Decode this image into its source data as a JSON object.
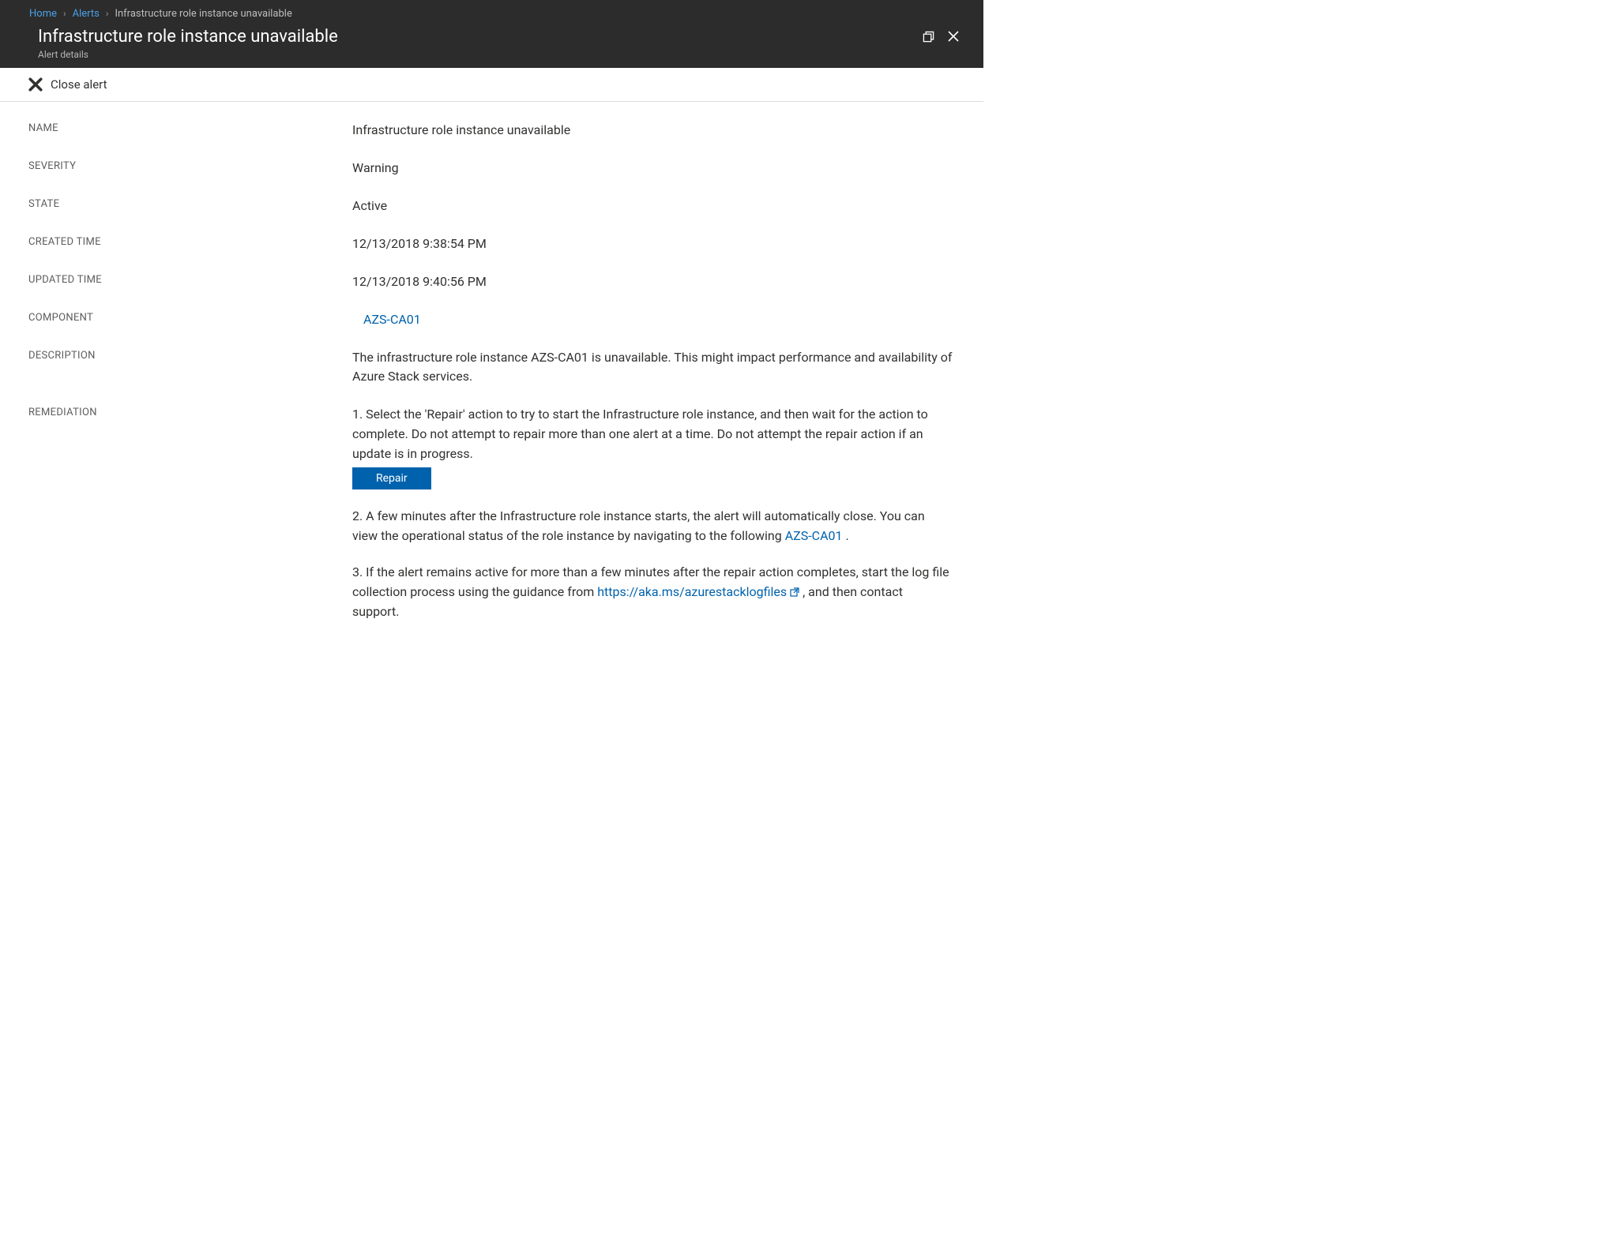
{
  "breadcrumb": {
    "home": "Home",
    "alerts": "Alerts",
    "current": "Infrastructure role instance unavailable"
  },
  "header": {
    "title": "Infrastructure role instance unavailable",
    "subtitle": "Alert details"
  },
  "toolbar": {
    "close_alert": "Close alert"
  },
  "fields": {
    "name_label": "NAME",
    "name_value": "Infrastructure role instance unavailable",
    "severity_label": "SEVERITY",
    "severity_value": "Warning",
    "state_label": "STATE",
    "state_value": "Active",
    "created_label": "CREATED TIME",
    "created_value": "12/13/2018 9:38:54 PM",
    "updated_label": "UPDATED TIME",
    "updated_value": "12/13/2018 9:40:56 PM",
    "component_label": "COMPONENT",
    "component_value": "AZS-CA01",
    "description_label": "DESCRIPTION",
    "description_value": "The infrastructure role instance AZS-CA01 is unavailable. This might impact performance and availability of Azure Stack services.",
    "remediation_label": "REMEDIATION"
  },
  "remediation": {
    "step1": "1. Select the 'Repair' action to try to start the Infrastructure role instance, and then wait for the action to complete. Do not attempt to repair more than one alert at a time. Do not attempt the repair action if an update is in progress.",
    "repair_button": "Repair",
    "step2_a": "2. A few minutes after the Infrastructure role instance starts, the alert will automatically close. You can view the operational status of the role instance by navigating to the following ",
    "step2_link": "AZS-CA01",
    "step2_b": " .",
    "step3_a": "3. If the alert remains active for more than a few minutes after the repair action completes, start the log file collection process using the guidance from ",
    "step3_link": "https://aka.ms/azurestacklogfiles",
    "step3_b": " , and then contact support."
  }
}
